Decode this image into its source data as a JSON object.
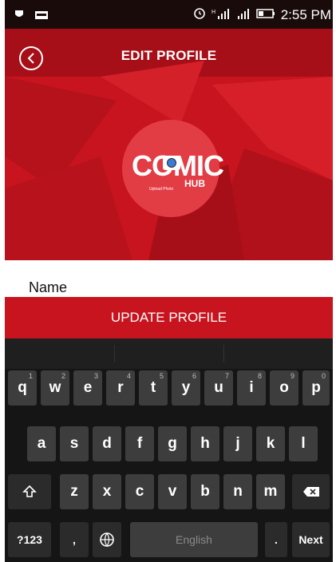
{
  "status_bar": {
    "time": "2:55 PM",
    "icons": [
      "shield-icon",
      "app-badge-icon",
      "alarm-icon",
      "signal-icon",
      "signal-icon",
      "battery-icon"
    ]
  },
  "header": {
    "title": "EDIT PROFILE",
    "back_icon": "back-arrow-icon",
    "accent": "#c8141e"
  },
  "avatar": {
    "logo_text": "COMIC",
    "logo_sub": "HUB",
    "upload_text": "Upload Photo",
    "camera_icon": "camera-icon"
  },
  "form": {
    "name_label": "Name"
  },
  "update_button": {
    "label": "UPDATE PROFILE"
  },
  "keyboard": {
    "row1": [
      {
        "key": "q",
        "hint": "1"
      },
      {
        "key": "w",
        "hint": "2"
      },
      {
        "key": "e",
        "hint": "3"
      },
      {
        "key": "r",
        "hint": "4"
      },
      {
        "key": "t",
        "hint": "5"
      },
      {
        "key": "y",
        "hint": "6"
      },
      {
        "key": "u",
        "hint": "7"
      },
      {
        "key": "i",
        "hint": "8"
      },
      {
        "key": "o",
        "hint": "9"
      },
      {
        "key": "p",
        "hint": "0"
      }
    ],
    "row2": [
      "a",
      "s",
      "d",
      "f",
      "g",
      "h",
      "j",
      "k",
      "l"
    ],
    "row3": [
      "z",
      "x",
      "c",
      "v",
      "b",
      "n",
      "m"
    ],
    "shift_icon": "shift-icon",
    "backspace_icon": "backspace-icon",
    "symbols_label": "?123",
    "comma_label": ",",
    "globe_icon": "globe-icon",
    "space_label": "English",
    "period_label": ".",
    "next_label": "Next"
  }
}
